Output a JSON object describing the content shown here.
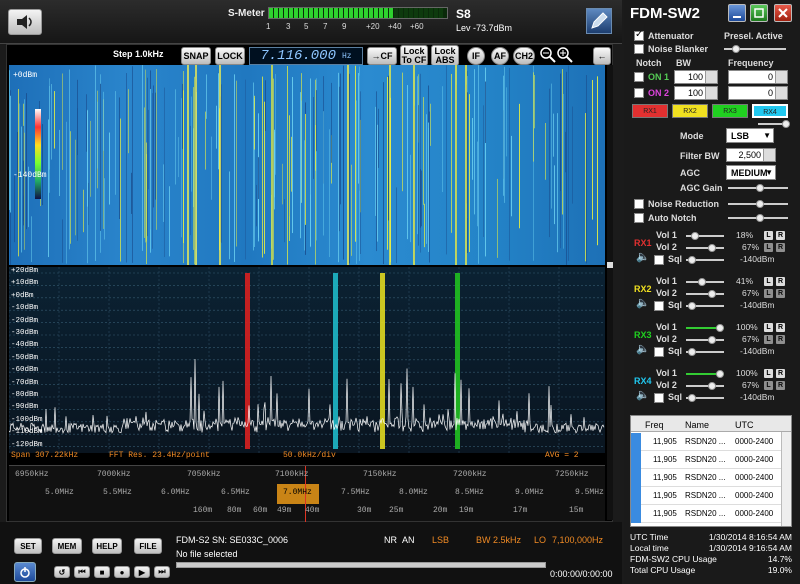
{
  "app": {
    "title": "FDM-SW2"
  },
  "smeter": {
    "label": "S-Meter",
    "value": "S8",
    "level": "Lev -73.7dBm",
    "scale": [
      "1",
      "3",
      "5",
      "7",
      "9",
      "+20",
      "+40",
      "+60"
    ]
  },
  "controls": {
    "step": "Step 1.0kHz",
    "snap": "SNAP",
    "lock": "LOCK",
    "frequency": "7.116.000",
    "freq_unit": "Hz",
    "to_cf": "→CF",
    "lock_to_cf": "Lock To CF",
    "lock_abs": "Lock ABS",
    "if": "IF",
    "af": "AF",
    "ch2": "CH2"
  },
  "waterfall": {
    "top": "+0dBm",
    "bottom": "-140dBm"
  },
  "spectrum": {
    "db_labels": [
      "+20dBm",
      "+10dBm",
      "+0dBm",
      "-10dBm",
      "-20dBm",
      "-30dBm",
      "-40dBm",
      "-50dBm",
      "-60dBm",
      "-70dBm",
      "-80dBm",
      "-90dBm",
      "-100dBm",
      "-110dBm",
      "-120dBm"
    ],
    "span": "Span 307.22kHz",
    "fft": "FFT Res. 23.4Hz/point",
    "div": "50.0kHz/div",
    "avg": "AVG = 2"
  },
  "freq_scale": {
    "khz": [
      "6950kHz",
      "7000kHz",
      "7050kHz",
      "7100kHz",
      "7150kHz",
      "7200kHz",
      "7250kHz"
    ],
    "mhz": [
      "5.0MHz",
      "5.5MHz",
      "6.0MHz",
      "6.5MHz",
      "7.0MHz",
      "7.5MHz",
      "8.0MHz",
      "8.5MHz",
      "9.0MHz",
      "9.5MHz"
    ],
    "bands": [
      "160m",
      "80m",
      "60m",
      "49m",
      "40m",
      "30m",
      "25m",
      "20m",
      "19m",
      "17m",
      "15m"
    ]
  },
  "right": {
    "attenuator": "Attenuator",
    "presel": "Presel. Active",
    "noise_blanker": "Noise Blanker",
    "notch": "Notch",
    "bw": "BW",
    "frequency": "Frequency",
    "on1": "ON 1",
    "on2": "ON 2",
    "bw1": "100",
    "bw2": "100",
    "f1": "0",
    "f2": "0",
    "rx": [
      "RX1",
      "RX2",
      "RX3",
      "RX4"
    ],
    "mode_label": "Mode",
    "mode": "LSB",
    "filter_label": "Filter BW",
    "filter": "2,500",
    "agc_label": "AGC",
    "agc": "MEDIUM",
    "agc_gain": "AGC Gain",
    "noise_reduction": "Noise Reduction",
    "auto_notch": "Auto Notch"
  },
  "receivers": [
    {
      "label": "RX1",
      "color": "#e23030",
      "vol1": "18%",
      "vol2": "67%",
      "sql": "-140dBm"
    },
    {
      "label": "RX2",
      "color": "#f0e020",
      "vol1": "41%",
      "vol2": "67%",
      "sql": "-140dBm"
    },
    {
      "label": "RX3",
      "color": "#20d020",
      "vol1": "100%",
      "vol2": "67%",
      "sql": "-140dBm"
    },
    {
      "label": "RX4",
      "color": "#20c8f0",
      "vol1": "100%",
      "vol2": "67%",
      "sql": "-140dBm"
    }
  ],
  "rx_labels": {
    "vol1": "Vol 1",
    "vol2": "Vol 2",
    "sql": "Sql",
    "l": "L",
    "r": "R"
  },
  "table": {
    "headers": [
      "Freq",
      "Name",
      "UTC"
    ],
    "rows": [
      [
        "11,905",
        "RSDN20 ...",
        "0000-2400"
      ],
      [
        "11,905",
        "RSDN20 ...",
        "0000-2400"
      ],
      [
        "11,905",
        "RSDN20 ...",
        "0000-2400"
      ],
      [
        "11,905",
        "RSDN20 ...",
        "0000-2400"
      ],
      [
        "11,905",
        "RSDN20 ...",
        "0000-2400"
      ]
    ]
  },
  "bottom": {
    "set": "SET",
    "mem": "MEM",
    "help": "HELP",
    "file": "FILE",
    "device": "FDM-S2 SN: SE033C_0006",
    "file_status": "No file selected",
    "nr": "NR",
    "an": "AN",
    "mode": "LSB",
    "bw": "BW 2.5kHz",
    "lo": "LO",
    "lo_freq": "7,100,000Hz",
    "time": "0:00:00/0:00:00"
  },
  "status": {
    "utc_label": "UTC Time",
    "utc": "1/30/2014 8:16:54 AM",
    "local_label": "Local time",
    "local": "1/30/2014 9:16:54 AM",
    "cpu_label": "FDM-SW2 CPU Usage",
    "cpu": "14.7%",
    "total_label": "Total CPU Usage",
    "total": "19.0%"
  },
  "colors": {
    "accent": "#2a85cc",
    "rx1": "#e23030",
    "rx2": "#f0e020",
    "rx3": "#20d020",
    "rx4": "#20c8f0",
    "info": "#f08a24"
  }
}
